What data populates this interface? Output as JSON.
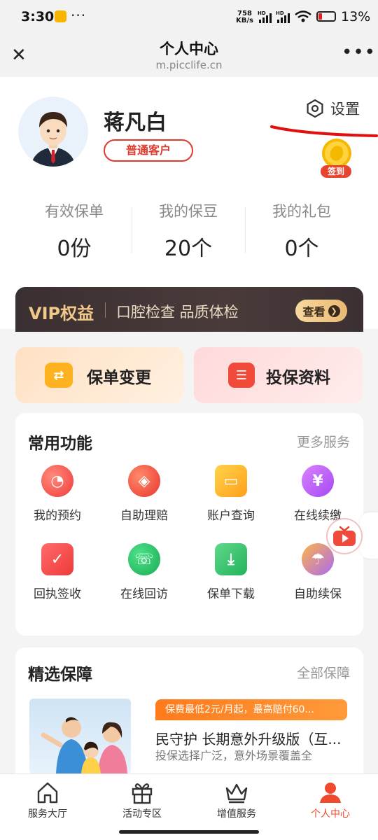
{
  "status_bar": {
    "time": "3:30",
    "more": "···",
    "net_speed_value": "758",
    "net_speed_unit": "KB/s",
    "battery": "13%",
    "battery_level_percent": 13
  },
  "nav": {
    "title": "个人中心",
    "url": "m.picclife.cn"
  },
  "profile": {
    "name": "蒋凡白",
    "level": "普通客户",
    "settings_label": "设置",
    "signin_label": "签到"
  },
  "stats": [
    {
      "label": "有效保单",
      "value": "0份"
    },
    {
      "label": "我的保豆",
      "value": "20个"
    },
    {
      "label": "我的礼包",
      "value": "0个"
    }
  ],
  "vip": {
    "title": "VIP权益",
    "desc": "口腔检查 品质体检",
    "button": "查看"
  },
  "quick": {
    "policy_change": "保单变更",
    "insure_info": "投保资料"
  },
  "common": {
    "title": "常用功能",
    "more": "更多服务",
    "items": [
      {
        "label": "我的预约",
        "icon": "clock-icon"
      },
      {
        "label": "自助理赔",
        "icon": "shield-bag-icon"
      },
      {
        "label": "账户查询",
        "icon": "wallet-icon"
      },
      {
        "label": "在线续缴",
        "icon": "yen-icon"
      },
      {
        "label": "回执签收",
        "icon": "check-clipboard-icon"
      },
      {
        "label": "在线回访",
        "icon": "phone-icon"
      },
      {
        "label": "保单下载",
        "icon": "download-icon"
      },
      {
        "label": "自助续保",
        "icon": "umbrella-icon"
      }
    ]
  },
  "featured": {
    "title": "精选保障",
    "more": "全部保障",
    "product": {
      "tag": "保费最低2元/月起，最高赔付60...",
      "name": "民守护 长期意外升级版（互...",
      "desc": "投保选择广泛，意外场景覆盖全"
    }
  },
  "tabbar": [
    {
      "label": "服务大厅",
      "icon": "home-icon",
      "active": false
    },
    {
      "label": "活动专区",
      "icon": "gift-icon",
      "active": false
    },
    {
      "label": "增值服务",
      "icon": "crown-icon",
      "active": false
    },
    {
      "label": "个人中心",
      "icon": "person-icon",
      "active": true
    }
  ],
  "colors": {
    "accent": "#e8432e",
    "vip_gold": "#f0c98a",
    "orange": "#ff7a1a"
  }
}
